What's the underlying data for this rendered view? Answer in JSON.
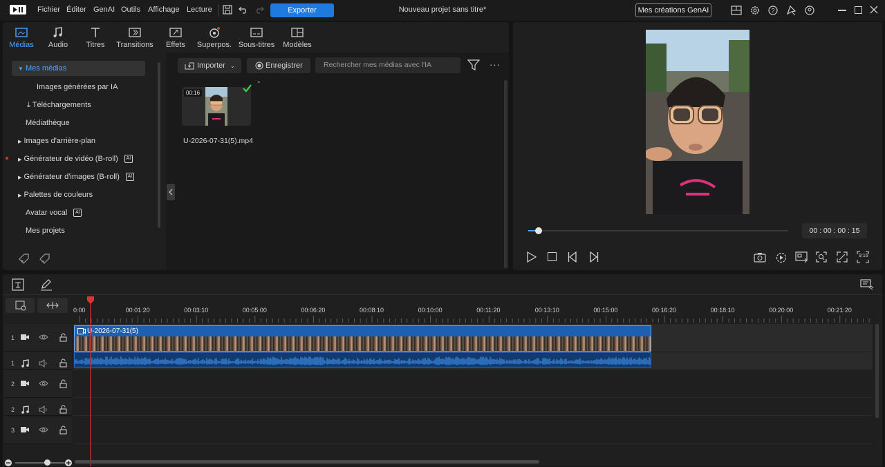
{
  "menu": {
    "items": [
      "Fichier",
      "Éditer",
      "GenAI",
      "Outils",
      "Affichage",
      "Lecture"
    ],
    "export_label": "Exporter",
    "doc_title": "Nouveau projet sans titre*",
    "genai_label": "Mes créations GenAI"
  },
  "tabs": [
    {
      "label": "Médias",
      "icon": "media-icon"
    },
    {
      "label": "Audio",
      "icon": "music-note-icon"
    },
    {
      "label": "Titres",
      "icon": "text-icon"
    },
    {
      "label": "Transitions",
      "icon": "transition-icon"
    },
    {
      "label": "Effets",
      "icon": "effects-icon"
    },
    {
      "label": "Superpos.",
      "icon": "overlay-icon"
    },
    {
      "label": "Sous-titres",
      "icon": "subtitles-icon"
    },
    {
      "label": "Modèles",
      "icon": "templates-icon"
    }
  ],
  "sidebar": {
    "items": [
      {
        "label": "Mes médias"
      },
      {
        "label": "Images générées par IA"
      },
      {
        "label": "Téléchargements"
      },
      {
        "label": "Médiathèque"
      },
      {
        "label": "Images d'arrière-plan"
      },
      {
        "label": "Générateur de vidéo (B-roll)"
      },
      {
        "label": "Générateur d'images (B-roll)"
      },
      {
        "label": "Palettes de couleurs"
      },
      {
        "label": "Avatar vocal"
      },
      {
        "label": "Mes projets"
      }
    ]
  },
  "library": {
    "import_label": "Importer",
    "record_label": "Enregistrer",
    "search_placeholder": "Rechercher mes médias avec l'IA",
    "media": {
      "duration": "00:16",
      "filename": "U-2026-07-31(5).mp4"
    }
  },
  "preview": {
    "timecode": "00 : 00 : 00 : 15",
    "progress": 0.04,
    "aspect_label": "9:16"
  },
  "timeline": {
    "ruler_labels": [
      "0:00",
      "00:01:20",
      "00:03:10",
      "00:05:00",
      "00:06:20",
      "00:08:10",
      "00:10:00",
      "00:11:20",
      "00:13:10",
      "00:15:00",
      "00:16:20",
      "00:18:10",
      "00:20:00",
      "00:21:20"
    ],
    "tracks": [
      {
        "num": "1",
        "type": "video"
      },
      {
        "num": "1",
        "type": "audio"
      },
      {
        "num": "2",
        "type": "video"
      },
      {
        "num": "2",
        "type": "audio"
      },
      {
        "num": "3",
        "type": "video"
      }
    ],
    "clip_label": "U-2026-07-31(5)"
  },
  "colors": {
    "accent": "#1f7ae0",
    "playhead": "#e03030",
    "clip": "#1f5fb0"
  }
}
